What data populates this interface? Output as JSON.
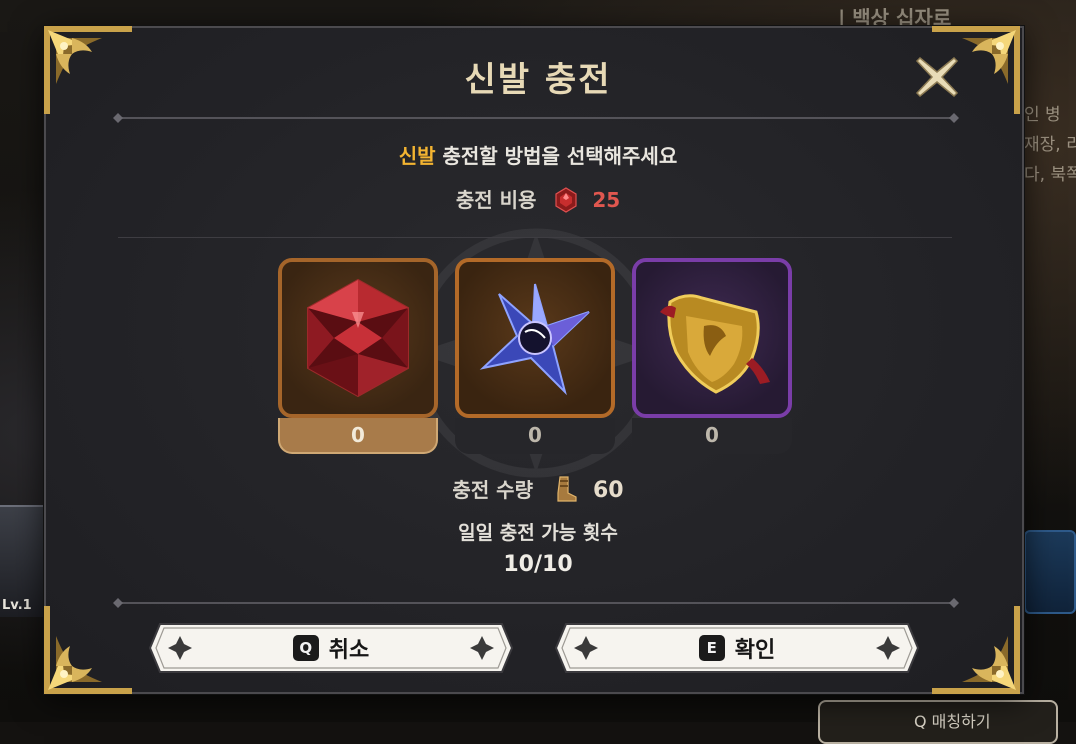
{
  "dialog": {
    "title": "신발 충전",
    "subtitle_highlight": "신발",
    "subtitle_rest": " 충전할 방법을 선택해주세요",
    "cost_label": "충전 비용",
    "cost_value": "25",
    "cost_icon": "red-gem-icon",
    "options": [
      {
        "name": "red-gem",
        "count": "0",
        "selected": true,
        "icon": "red-gem-icon"
      },
      {
        "name": "blue-star-shard",
        "count": "0",
        "selected": false,
        "icon": "blue-star-shard-icon"
      },
      {
        "name": "golden-shield",
        "count": "0",
        "selected": false,
        "icon": "golden-shield-icon"
      }
    ],
    "charge_label": "충전 수량",
    "charge_value": "60",
    "charge_icon": "boot-icon",
    "daily_label": "일일 충전 가능 횟수",
    "daily_value": "10/10",
    "buttons": {
      "cancel_key": "Q",
      "cancel_label": "취소",
      "confirm_key": "E",
      "confirm_label": "확인"
    }
  },
  "background": {
    "top_text": "| 백상 십자로",
    "right_text_lines": [
      "인 병",
      "재장, 리",
      "다, 북쪽"
    ],
    "portrait_level": "Lv.1",
    "bottom_button": "Q 매칭하기"
  },
  "colors": {
    "highlight": "#f3b431",
    "cost_value": "#e0574f",
    "title": "#e7d9b6",
    "panel": "#232327",
    "frame_gold": "#c9a24a"
  }
}
